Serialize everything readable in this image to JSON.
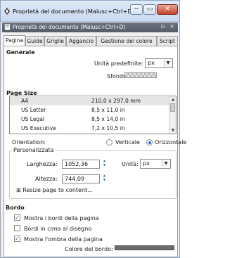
{
  "window": {
    "title": "Proprietà del documento (Maiusc+Ctrl+D)",
    "min_glyph": "−",
    "max_glyph": "▭",
    "close_glyph": "✕"
  },
  "dock": {
    "title": "Proprietà del documento (Maiusc+Ctrl+D)",
    "btn_a": "⊡",
    "btn_b": "✕"
  },
  "tabs": [
    "Pagina",
    "Guide",
    "Griglie",
    "Aggancio",
    "Gestione del colore",
    "Script"
  ],
  "generale": {
    "heading": "Generale",
    "unit_label": "Unità predefinite:",
    "unit_value": "px",
    "bg_label": "Sfondo:"
  },
  "page_size": {
    "heading": "Page Size",
    "rows": [
      {
        "name": "A4",
        "size": "210,0 x 297,0 mm"
      },
      {
        "name": "US Letter",
        "size": "8,5 x 11,0 in"
      },
      {
        "name": "US Legal",
        "size": "8,5 x 14,0 in"
      },
      {
        "name": "US Executive",
        "size": "7,2 x 10,5 in"
      }
    ],
    "orientation_label": "Orientation:",
    "portrait_label": "Verticale",
    "landscape_label": "Orizzontale"
  },
  "custom": {
    "title": "Personalizzata",
    "width_label": "Larghezza:",
    "width_value": "1052,36",
    "height_label": "Altezza:",
    "height_value": "744,09",
    "units_label": "Unità:",
    "units_value": "px",
    "resize_label": "Resize page to content..."
  },
  "bordo": {
    "heading": "Bordo",
    "show_border": "Mostra i bordi della pagina",
    "border_on_top": "Bordi in cima al disegno",
    "show_shadow": "Mostra l'ombra della pagina",
    "border_color_label": "Colore del bordo:"
  },
  "icons": {
    "doc": "document-properties-icon",
    "spin_up": "▲",
    "spin_down": "▼",
    "combo_arrow": "▼",
    "expander": "⊞",
    "check": "✓",
    "scroll_up": "▲",
    "scroll_down": "▼"
  },
  "colors": {
    "border_color": "#6b6b6b",
    "accent": "#2f6fd0"
  }
}
